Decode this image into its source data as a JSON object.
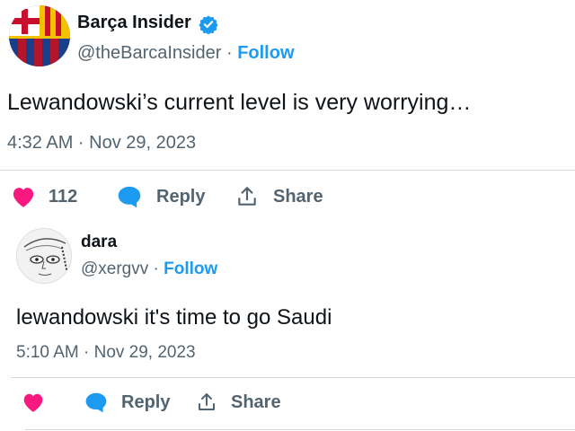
{
  "tweet": {
    "author_name": "Barça Insider",
    "author_handle": "@theBarcaInsider",
    "separator": "·",
    "follow_label": "Follow",
    "text": "Lewandowski’s current level is very worrying…",
    "timestamp": "4:32 AM · Nov 29, 2023",
    "like_count": "112",
    "reply_label": "Reply",
    "share_label": "Share"
  },
  "reply": {
    "author_name": "dara",
    "author_handle": "@xergvv",
    "separator": "·",
    "follow_label": "Follow",
    "text": "lewandowski it's time to go Saudi",
    "timestamp": "5:10 AM · Nov 29, 2023",
    "reply_label": "Reply",
    "share_label": "Share"
  },
  "colors": {
    "like": "#f91880",
    "reply": "#1d9bf0",
    "follow": "#1d9bf0",
    "verified": "#1d9bf0",
    "crest_blue": "#1a3f8a",
    "crest_red": "#b3152b",
    "crest_yellow": "#f2c200"
  },
  "icons": {
    "verified": "verified-badge-icon",
    "like": "heart-icon",
    "reply": "speech-bubble-icon",
    "share": "share-upload-icon"
  }
}
